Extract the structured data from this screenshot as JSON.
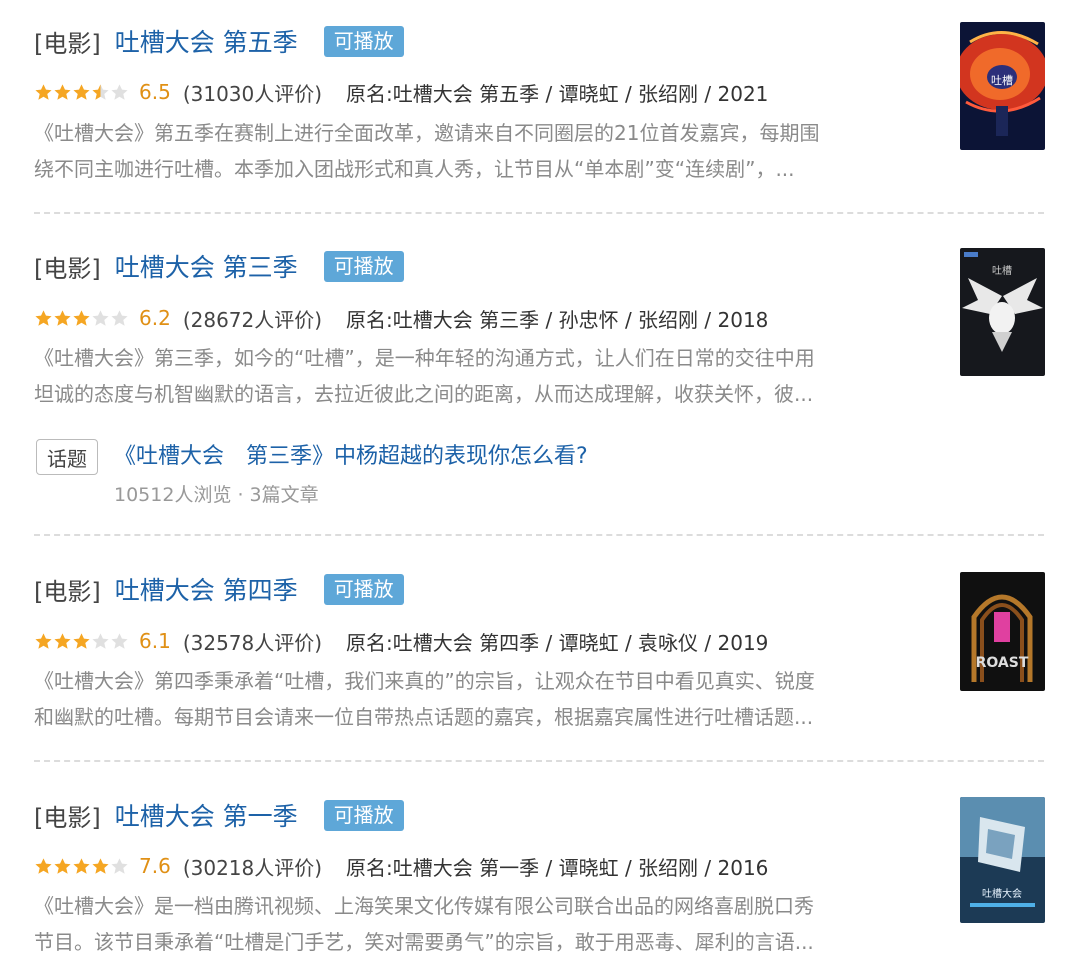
{
  "results": [
    {
      "category": "[电影]",
      "title": "吐槽大会 第五季",
      "badge": "可播放",
      "stars": 3.5,
      "rating": "6.5",
      "rating_count": "(31030人评价)",
      "original": "原名:吐槽大会 第五季 / 谭晓虹 / 张绍刚 / 2021",
      "desc1": "《吐槽大会》第五季在赛制上进行全面改革，邀请来自不同圈层的21位首发嘉宾，每期围",
      "desc2": "绕不同主咖进行吐槽。本季加入团战形式和真人秀，让节目从“单本剧”变“连续剧”，...",
      "poster": "poster-season-5"
    },
    {
      "category": "[电影]",
      "title": "吐槽大会 第三季",
      "badge": "可播放",
      "stars": 3,
      "rating": "6.2",
      "rating_count": "(28672人评价)",
      "original": "原名:吐槽大会 第三季 / 孙忠怀 / 张绍刚 / 2018",
      "desc1": "《吐槽大会》第三季，如今的“吐槽”，是一种年轻的沟通方式，让人们在日常的交往中用",
      "desc2": "坦诚的态度与机智幽默的语言，去拉近彼此之间的距离，从而达成理解，收获关怀，彼...",
      "poster": "poster-season-3"
    },
    {
      "category": "[电影]",
      "title": "吐槽大会 第四季",
      "badge": "可播放",
      "stars": 3,
      "rating": "6.1",
      "rating_count": "(32578人评价)",
      "original": "原名:吐槽大会 第四季 / 谭晓虹 / 袁咏仪 / 2019",
      "desc1": "《吐槽大会》第四季秉承着“吐槽，我们来真的”的宗旨，让观众在节目中看见真实、锐度",
      "desc2": "和幽默的吐槽。每期节目会请来一位自带热点话题的嘉宾，根据嘉宾属性进行吐槽话题...",
      "poster": "poster-season-4"
    },
    {
      "category": "[电影]",
      "title": "吐槽大会 第一季",
      "badge": "可播放",
      "stars": 4,
      "rating": "7.6",
      "rating_count": "(30218人评价)",
      "original": "原名:吐槽大会 第一季 / 谭晓虹 / 张绍刚 / 2016",
      "desc1": "《吐槽大会》是一档由腾讯视频、上海笑果文化传媒有限公司联合出品的网络喜剧脱口秀",
      "desc2": "节目。该节目秉承着“吐槽是门手艺，笑对需要勇气”的宗旨，敢于用恶毒、犀利的言语...",
      "poster": "poster-season-1"
    }
  ],
  "topic": {
    "tag": "话题",
    "title": "《吐槽大会　第三季》中杨超越的表现你怎么看?",
    "meta": "10512人浏览 · 3篇文章"
  },
  "colors": {
    "link": "#1d62a8",
    "badge": "#5ea7d8",
    "star_on": "#f5a623",
    "star_off": "#e0e0e0",
    "rating": "#e09015"
  }
}
